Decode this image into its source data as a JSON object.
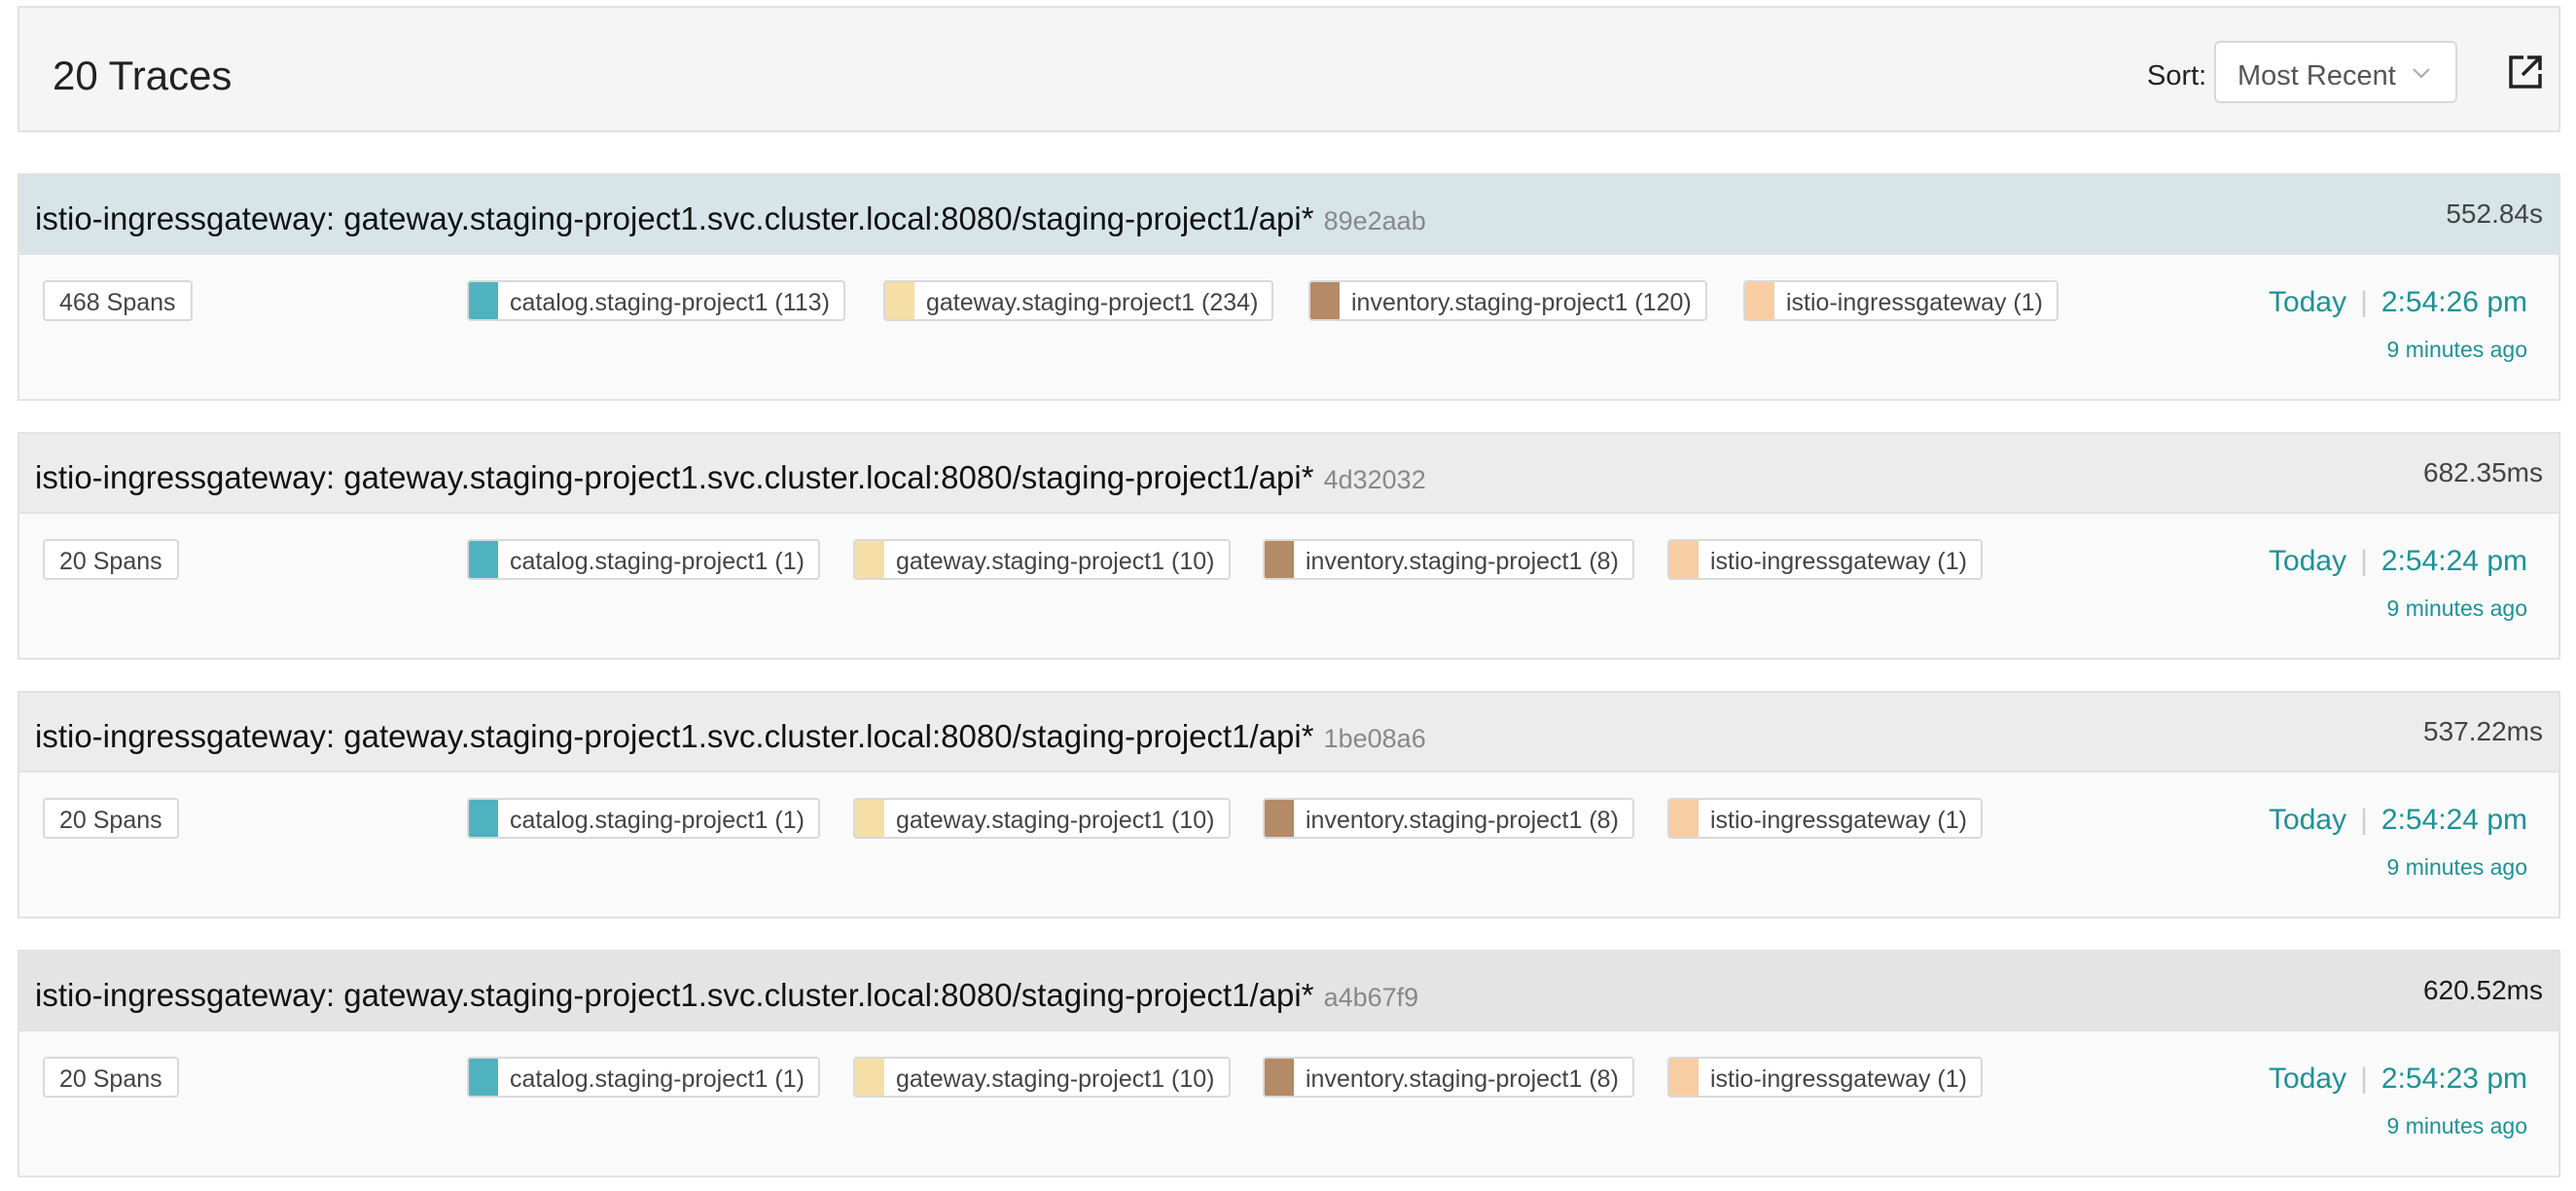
{
  "header": {
    "title": "20 Traces",
    "sort_label": "Sort:",
    "sort_value": "Most Recent",
    "open_icon": "external-link-icon"
  },
  "colors": {
    "catalog": "#4fb3bf",
    "gateway": "#f5dfa6",
    "inventory": "#b58a66",
    "istio": "#f9cda2",
    "accent_teal": "#1d9296",
    "trace_head_highlight": "#d7e5e9",
    "trace_head_default": "#ececec",
    "trace_head_hover": "#e4e4e4"
  },
  "traces": [
    {
      "title": "istio-ingressgateway: gateway.staging-project1.svc.cluster.local:8080/staging-project1/api*",
      "id": "89e2aab",
      "duration": "552.84s",
      "spans": "468 Spans",
      "services": [
        {
          "label": "catalog.staging-project1 (113)",
          "color": "#4fb3bf"
        },
        {
          "label": "gateway.staging-project1 (234)",
          "color": "#f5dfa6"
        },
        {
          "label": "inventory.staging-project1 (120)",
          "color": "#b58a66"
        },
        {
          "label": "istio-ingressgateway (1)",
          "color": "#f9cda2"
        }
      ],
      "day": "Today",
      "time": "2:54:26 pm",
      "ago": "9 minutes ago"
    },
    {
      "title": "istio-ingressgateway: gateway.staging-project1.svc.cluster.local:8080/staging-project1/api*",
      "id": "4d32032",
      "duration": "682.35ms",
      "spans": "20 Spans",
      "services": [
        {
          "label": "catalog.staging-project1 (1)",
          "color": "#4fb3bf"
        },
        {
          "label": "gateway.staging-project1 (10)",
          "color": "#f5dfa6"
        },
        {
          "label": "inventory.staging-project1 (8)",
          "color": "#b58a66"
        },
        {
          "label": "istio-ingressgateway (1)",
          "color": "#f9cda2"
        }
      ],
      "day": "Today",
      "time": "2:54:24 pm",
      "ago": "9 minutes ago"
    },
    {
      "title": "istio-ingressgateway: gateway.staging-project1.svc.cluster.local:8080/staging-project1/api*",
      "id": "1be08a6",
      "duration": "537.22ms",
      "spans": "20 Spans",
      "services": [
        {
          "label": "catalog.staging-project1 (1)",
          "color": "#4fb3bf"
        },
        {
          "label": "gateway.staging-project1 (10)",
          "color": "#f5dfa6"
        },
        {
          "label": "inventory.staging-project1 (8)",
          "color": "#b58a66"
        },
        {
          "label": "istio-ingressgateway (1)",
          "color": "#f9cda2"
        }
      ],
      "day": "Today",
      "time": "2:54:24 pm",
      "ago": "9 minutes ago"
    },
    {
      "title": "istio-ingressgateway: gateway.staging-project1.svc.cluster.local:8080/staging-project1/api*",
      "id": "a4b67f9",
      "duration": "620.52ms",
      "spans": "20 Spans",
      "services": [
        {
          "label": "catalog.staging-project1 (1)",
          "color": "#4fb3bf"
        },
        {
          "label": "gateway.staging-project1 (10)",
          "color": "#f5dfa6"
        },
        {
          "label": "inventory.staging-project1 (8)",
          "color": "#b58a66"
        },
        {
          "label": "istio-ingressgateway (1)",
          "color": "#f9cda2"
        }
      ],
      "day": "Today",
      "time": "2:54:23 pm",
      "ago": "9 minutes ago"
    }
  ]
}
